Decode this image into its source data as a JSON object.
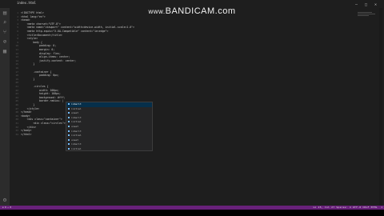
{
  "watermark": {
    "prefix": "www.",
    "brand": "BANDICAM",
    "suffix": ".com"
  },
  "tab": {
    "label": "index.html"
  },
  "window_controls": "— □ ✕",
  "activity_icons": [
    "files-icon",
    "search-icon",
    "source-control-icon",
    "debug-icon",
    "extensions-icon"
  ],
  "code_lines": [
    {
      "n": "1",
      "text": "<!DOCTYPE html>"
    },
    {
      "n": "2",
      "text": "<html lang=\"en\">"
    },
    {
      "n": "3",
      "text": "<head>"
    },
    {
      "n": "4",
      "text": "    <meta charset=\"UTF-8\">"
    },
    {
      "n": "5",
      "text": "    <meta name=\"viewport\" content=\"width=device-width, initial-scale=1.0\">"
    },
    {
      "n": "6",
      "text": "    <meta http-equiv=\"X-UA-Compatible\" content=\"ie=edge\">"
    },
    {
      "n": "7",
      "text": "    <title>Document</title>"
    },
    {
      "n": "8",
      "text": "    <style>"
    },
    {
      "n": "9",
      "text": "        body {"
    },
    {
      "n": "10",
      "text": "            padding: 0;"
    },
    {
      "n": "11",
      "text": "            margin: 0;"
    },
    {
      "n": "12",
      "text": "            display: flex;"
    },
    {
      "n": "13",
      "text": "            align-items: center;"
    },
    {
      "n": "14",
      "text": "            justify-content: center;"
    },
    {
      "n": "15",
      "text": "        }"
    },
    {
      "n": "16",
      "text": ""
    },
    {
      "n": "17",
      "text": "        .container {"
    },
    {
      "n": "18",
      "text": "            padding: 0px;"
    },
    {
      "n": "19",
      "text": "        }"
    },
    {
      "n": "20",
      "text": ""
    },
    {
      "n": "21",
      "text": "        .circles {"
    },
    {
      "n": "22",
      "text": "            width: 100px;"
    },
    {
      "n": "23",
      "text": "            height: 100px;"
    },
    {
      "n": "24",
      "text": "            background: #fff;"
    },
    {
      "n": "25",
      "text": "            border-radius: |"
    },
    {
      "n": "26",
      "text": "        }"
    },
    {
      "n": "27",
      "text": "    </style>"
    },
    {
      "n": "28",
      "text": "</head>"
    },
    {
      "n": "29",
      "text": "<body>"
    },
    {
      "n": "30",
      "text": "    <div class=\"container\">"
    },
    {
      "n": "31",
      "text": "        <div class=\"circles\"></div>"
    },
    {
      "n": "32",
      "text": "    </div>"
    },
    {
      "n": "33",
      "text": "</body>"
    },
    {
      "n": "34",
      "text": "</html>"
    }
  ],
  "suggestions": [
    "inherit",
    "initial",
    "unset",
    "inherit",
    "initial",
    "unset",
    "inherit",
    "initial",
    "unset",
    "inherit",
    "initial"
  ],
  "status": {
    "left": "⊗ 0 ⚠ 0",
    "right": "Ln 25, Col 27   Spaces: 4   UTF-8   CRLF   HTML"
  },
  "colors": {
    "status_bar": "#68217a",
    "editor_bg": "#1e1e1e"
  }
}
